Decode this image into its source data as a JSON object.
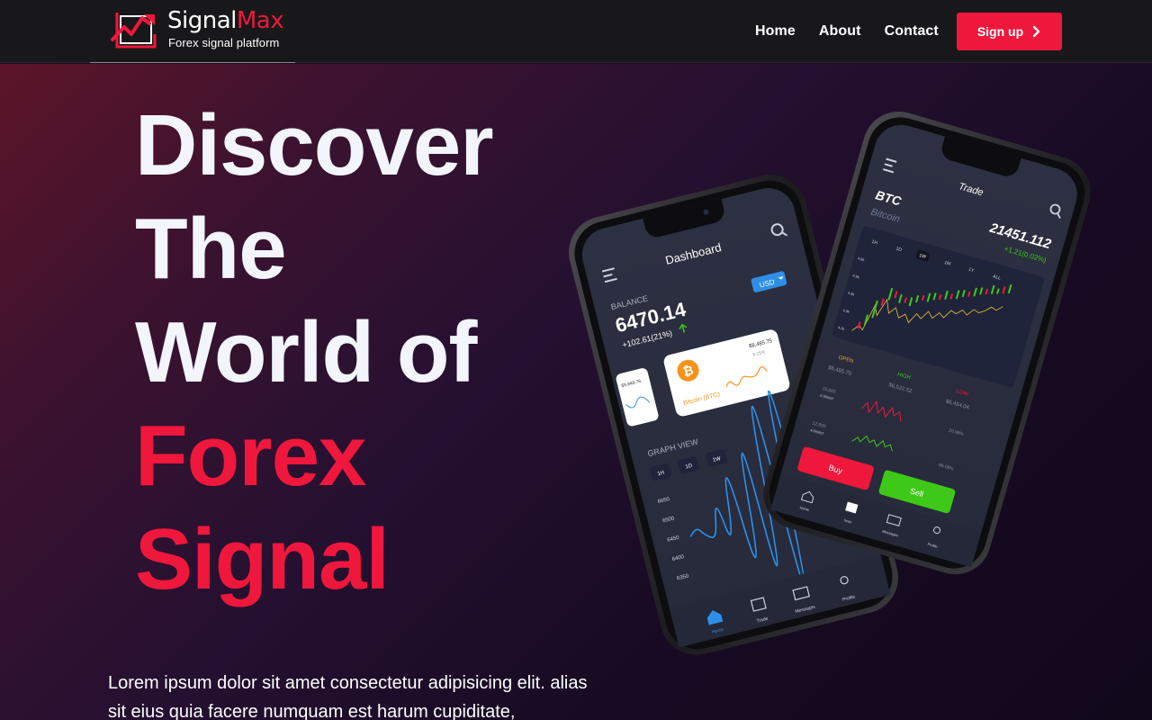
{
  "brand": {
    "name_part1": "Signal",
    "name_part2": "Max",
    "tagline": "Forex signal platform"
  },
  "nav": {
    "links": [
      "Home",
      "About",
      "Contact"
    ],
    "signup_label": "Sign up"
  },
  "hero": {
    "headline_white": [
      "Discover",
      "The",
      "World of"
    ],
    "headline_red": [
      "Forex",
      "Signal"
    ],
    "lead": "Lorem ipsum dolor sit amet consectetur adipisicing elit. alias sit eius quia facere numquam est harum cupiditate,"
  },
  "phone_dashboard": {
    "title": "Dashboard",
    "balance_label": "BALANCE",
    "balance_value": "6470.14",
    "balance_change": "+102.61(21%)",
    "currency": "USD",
    "card_value": "$8,485.75",
    "card_pct": "8.25%",
    "card_coin": "Bitcoin (BTC)",
    "side_card_value": "$9,848.76",
    "graph_label": "GRAPH VIEW",
    "graph_tabs": [
      "1H",
      "1D",
      "1W"
    ],
    "graph_levels": [
      "6650",
      "6500",
      "6450",
      "6400",
      "6350"
    ],
    "nav_items": [
      "Home",
      "Trade",
      "Messages",
      "Profile"
    ]
  },
  "phone_trade": {
    "title": "Trade",
    "symbol": "BTC",
    "coin": "Bitcoin",
    "price": "21451.112",
    "change": "+1.21(0.02%)",
    "chart_tabs": [
      "1H",
      "1D",
      "1W",
      "1M",
      "1Y",
      "ALL"
    ],
    "chart_levels": [
      "4.6k",
      "4.5k",
      "4.4k",
      "4.3k",
      "4.2k"
    ],
    "stats": [
      {
        "label": "OPEN",
        "value": "$6,485.75"
      },
      {
        "label": "HIGH",
        "value": "$6,522.52"
      },
      {
        "label": "LOW",
        "value": "$6,454.04"
      }
    ],
    "row1_left": [
      "15,500",
      "6.5%INT"
    ],
    "row1_right": "20.08%",
    "row2_left": [
      "12,500",
      "4.5%INT"
    ],
    "row2_right": "96.08%",
    "buy_label": "Buy",
    "sell_label": "Sell",
    "nav_items": [
      "Home",
      "Scan",
      "Messages",
      "Profile"
    ]
  },
  "colors": {
    "accent": "#f0173c",
    "navbar": "#18181a",
    "buy": "#f0173c",
    "sell": "#3ec918",
    "chart_line": "#2f8fe8"
  }
}
